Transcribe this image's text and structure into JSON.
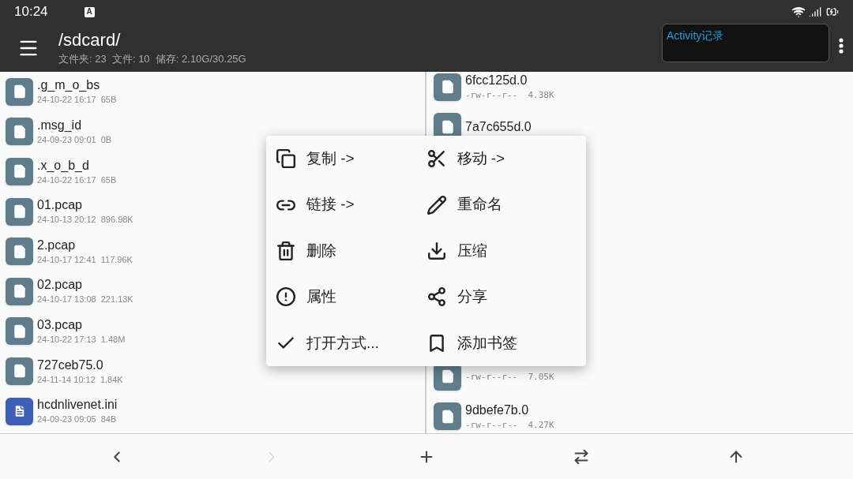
{
  "status_bar": {
    "time": "10:24",
    "notification": "A"
  },
  "toolbar": {
    "path": "/sdcard/",
    "summary": "文件夹: 23  文件: 10  储存: 2.10G/30.25G"
  },
  "overlay": {
    "title": "Activity记录"
  },
  "left_pane": {
    "rows": [
      {
        "kind": "file",
        "name": ".g_m_o_bs",
        "meta": "24-10-22 16:17  65B"
      },
      {
        "kind": "file",
        "name": ".msg_id",
        "meta": "24-09-23 09:01  0B"
      },
      {
        "kind": "file",
        "name": ".x_o_b_d",
        "meta": "24-10-22 16:17  65B"
      },
      {
        "kind": "file",
        "name": "01.pcap",
        "meta": "24-10-13 20:12  896.98K"
      },
      {
        "kind": "file",
        "name": "2.pcap",
        "meta": "24-10-17 12:41  117.96K"
      },
      {
        "kind": "file",
        "name": "02.pcap",
        "meta": "24-10-17 13:08  221.13K"
      },
      {
        "kind": "file",
        "name": "03.pcap",
        "meta": "24-10-22 17:13  1.48M"
      },
      {
        "kind": "file",
        "name": "727ceb75.0",
        "meta": "24-11-14 10:12  1.84K"
      },
      {
        "kind": "text",
        "name": "hcdnlivenet.ini",
        "meta": "24-09-23 09:05  84B"
      }
    ]
  },
  "right_pane": {
    "rows_top": [
      {
        "kind": "file",
        "name": "6fcc125d.0",
        "meta": "-rw-r--r--  4.38K"
      },
      {
        "kind": "file",
        "name": "7a7c655d.0"
      }
    ],
    "rows_bottom": [
      {
        "kind": "file",
        "meta": "-rw-r--r--  7.05K"
      },
      {
        "kind": "file",
        "name": "9dbefe7b.0",
        "meta": "-rw-r--r--  4.27K"
      }
    ]
  },
  "context_menu": [
    {
      "kind": "copy",
      "label": "复制 ->"
    },
    {
      "kind": "move",
      "label": "移动 ->"
    },
    {
      "kind": "link",
      "label": "链接 ->"
    },
    {
      "kind": "rename",
      "label": "重命名"
    },
    {
      "kind": "delete",
      "label": "删除"
    },
    {
      "kind": "compress",
      "label": "压缩"
    },
    {
      "kind": "properties",
      "label": "属性"
    },
    {
      "kind": "share",
      "label": "分享"
    },
    {
      "kind": "open_with",
      "label": "打开方式..."
    },
    {
      "kind": "bookmark",
      "label": "添加书签"
    }
  ],
  "bottom_bar": [
    {
      "kind": "back",
      "disabled": false
    },
    {
      "kind": "forward",
      "disabled": true
    },
    {
      "kind": "add",
      "disabled": false
    },
    {
      "kind": "swap",
      "disabled": false
    },
    {
      "kind": "up",
      "disabled": false
    }
  ]
}
